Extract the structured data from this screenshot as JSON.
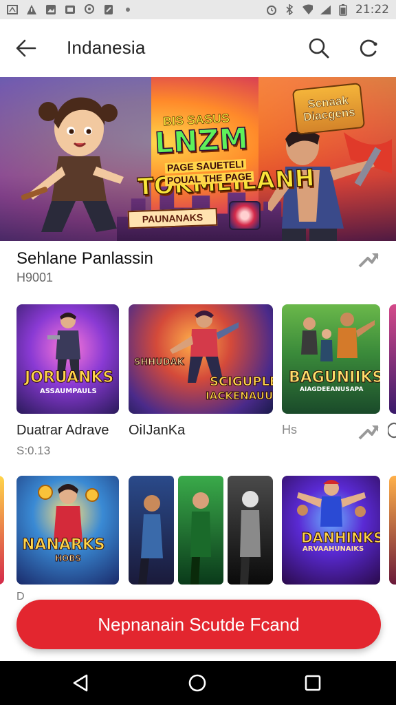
{
  "status_bar": {
    "time": "21:22",
    "icons_left": [
      "notification-icon",
      "warning-icon",
      "image-icon",
      "mail-icon",
      "location-icon",
      "clipboard-icon",
      "dot-icon"
    ],
    "icons_right": [
      "alarm-icon",
      "bluetooth-icon",
      "wifi-icon",
      "signal-icon",
      "battery-icon"
    ]
  },
  "app_bar": {
    "title": "Indanesia"
  },
  "banner": {
    "headline_line1": "TOKMEILANH",
    "headline_line2": "BIS SASUS",
    "headline_line3": "LNZM",
    "subline_a": "PAGE SAUETELI",
    "subline_b": "POUAL THE PAGE",
    "badge_line1": "Scnaak",
    "badge_line2": "Diacgens",
    "ribbon": "PAUNANAKS"
  },
  "section": {
    "title": "Sehlane Panlassin",
    "subtitle": "H9001"
  },
  "row1": {
    "cards": [
      {
        "logo_top": "JORUANKS",
        "logo_sub": "ASSAUMPAULS"
      },
      {
        "logo_top": "SHHUDAK",
        "logo_mid": "SCIGUPLE",
        "logo_bottom": "IACKENAUUN"
      },
      {
        "logo_top": "BAGUNIIKS",
        "logo_sub": "AIAGDEEANUSAPA"
      }
    ],
    "label_1": "Duatrar Adrave",
    "label_2": "OiIJanKa",
    "label_3": "Hs",
    "meta_1": "S:0.13"
  },
  "row2": {
    "cards": [
      {
        "logo_top": "NANARKS",
        "logo_sub": "HOBS"
      },
      {
        "logo_top": ""
      },
      {
        "logo_top": "DANHINKS",
        "logo_sub": "ARVAAHUNAIKS"
      }
    ],
    "peek_label": "D"
  },
  "cta": {
    "label": "Nepnanain Scutde Fcand"
  },
  "colors": {
    "accent": "#e3262f",
    "status_bar": "#e8e8e8",
    "nav_bar": "#000000"
  }
}
